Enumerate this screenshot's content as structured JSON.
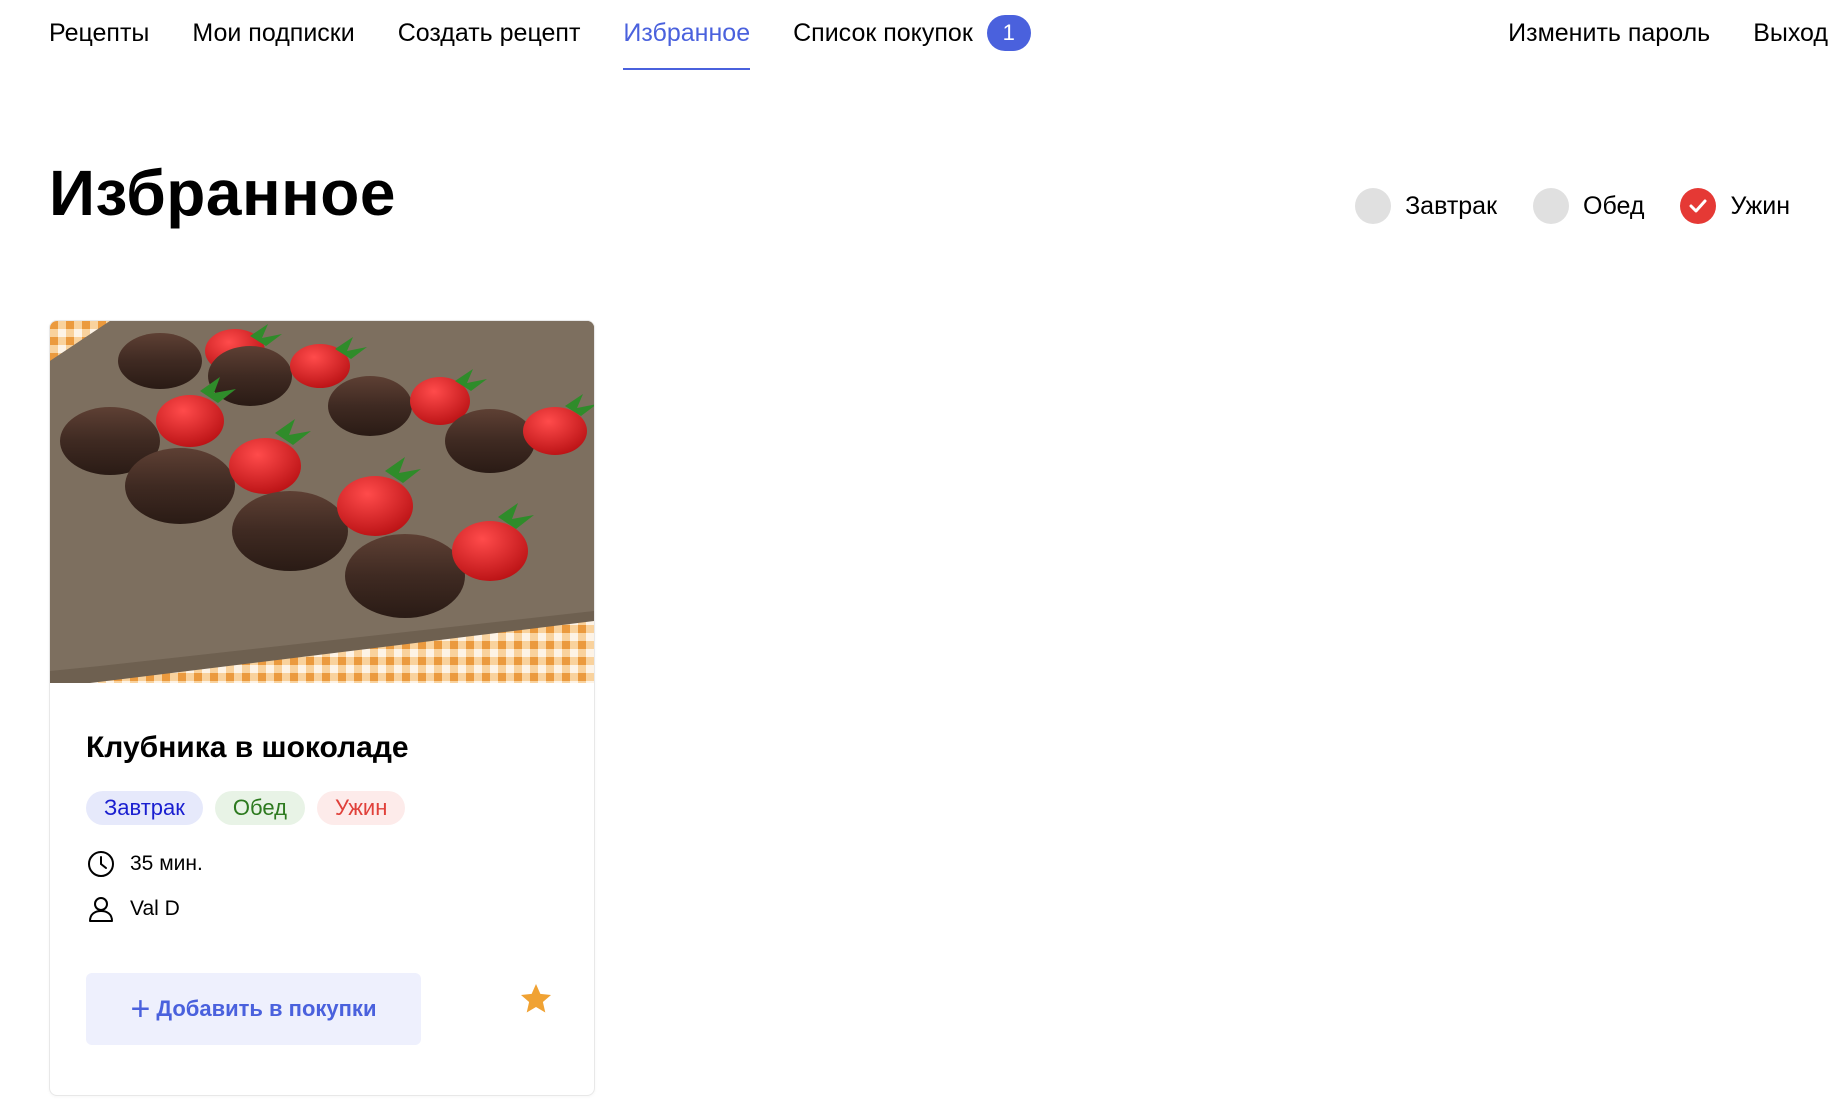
{
  "nav": {
    "left": [
      {
        "label": "Рецепты",
        "active": false
      },
      {
        "label": "Мои подписки",
        "active": false
      },
      {
        "label": "Создать рецепт",
        "active": false
      },
      {
        "label": "Избранное",
        "active": true
      },
      {
        "label": "Список покупок",
        "active": false,
        "badge": "1"
      }
    ],
    "right": [
      {
        "label": "Изменить пароль"
      },
      {
        "label": "Выход"
      }
    ],
    "accent_color": "#4a61dd"
  },
  "page": {
    "title": "Избранное"
  },
  "filters": [
    {
      "label": "Завтрак",
      "checked": false
    },
    {
      "label": "Обед",
      "checked": false
    },
    {
      "label": "Ужин",
      "checked": true
    }
  ],
  "recipes": [
    {
      "image_icon": "chocolate-strawberries-photo",
      "title": "Клубника в шоколаде",
      "tags": [
        {
          "label": "Завтрак",
          "color": "#1a1fd0"
        },
        {
          "label": "Обед",
          "color": "#2d7a1f"
        },
        {
          "label": "Ужин",
          "color": "#e0403a"
        }
      ],
      "time": "35 мин.",
      "author": "Val D",
      "add_button_label": "Добавить в покупки",
      "favorited": true,
      "star_color": "#f0a233"
    }
  ]
}
